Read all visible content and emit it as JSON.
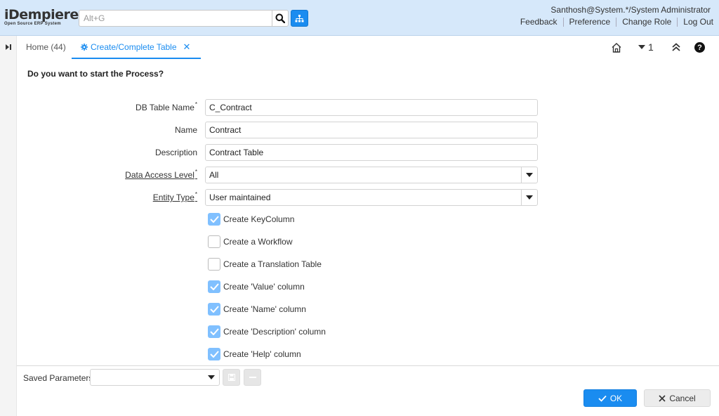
{
  "app": {
    "logo_text": "iDempiere",
    "logo_subtitle": "Open Source ERP System"
  },
  "header": {
    "search_placeholder": "Alt+G",
    "user": "Santhosh@System.*/System Administrator",
    "links": [
      "Feedback",
      "Preference",
      "Change Role",
      "Log Out"
    ]
  },
  "tabs": {
    "home_label": "Home (44)",
    "active_label": "Create/Complete Table",
    "open_count": "1"
  },
  "form": {
    "question": "Do you want to start the Process?",
    "fields": [
      {
        "label": "DB Table Name",
        "value": "C_Contract",
        "required": "*"
      },
      {
        "label": "Name",
        "value": "Contract"
      },
      {
        "label": "Description",
        "value": "Contract Table"
      },
      {
        "label": "Data Access Level",
        "value": "All",
        "required": "*"
      },
      {
        "label": "Entity Type",
        "value": "User maintained",
        "required": "*"
      }
    ],
    "checkboxes": [
      {
        "label": "Create KeyColumn",
        "checked": true
      },
      {
        "label": "Create a Workflow",
        "checked": false
      },
      {
        "label": "Create a Translation Table",
        "checked": false
      },
      {
        "label": "Create 'Value' column",
        "checked": true
      },
      {
        "label": "Create 'Name' column",
        "checked": true
      },
      {
        "label": "Create 'Description' column",
        "checked": true
      },
      {
        "label": "Create 'Help' column",
        "checked": true
      }
    ]
  },
  "footer": {
    "saved_parameters_label": "Saved Parameters",
    "ok_label": "OK",
    "cancel_label": "Cancel"
  },
  "colors": {
    "accent": "#1a8cf0",
    "header_bg": "#d6e8fa",
    "checkbox_on": "#80c0ff"
  },
  "icons": [
    "search-icon",
    "menu-tree-icon",
    "expand-panel-icon",
    "gear-icon",
    "close-icon",
    "home-icon",
    "chevron-down-icon",
    "double-chevron-up-icon",
    "help-icon",
    "save-icon",
    "minus-icon",
    "check-icon",
    "x-icon"
  ]
}
